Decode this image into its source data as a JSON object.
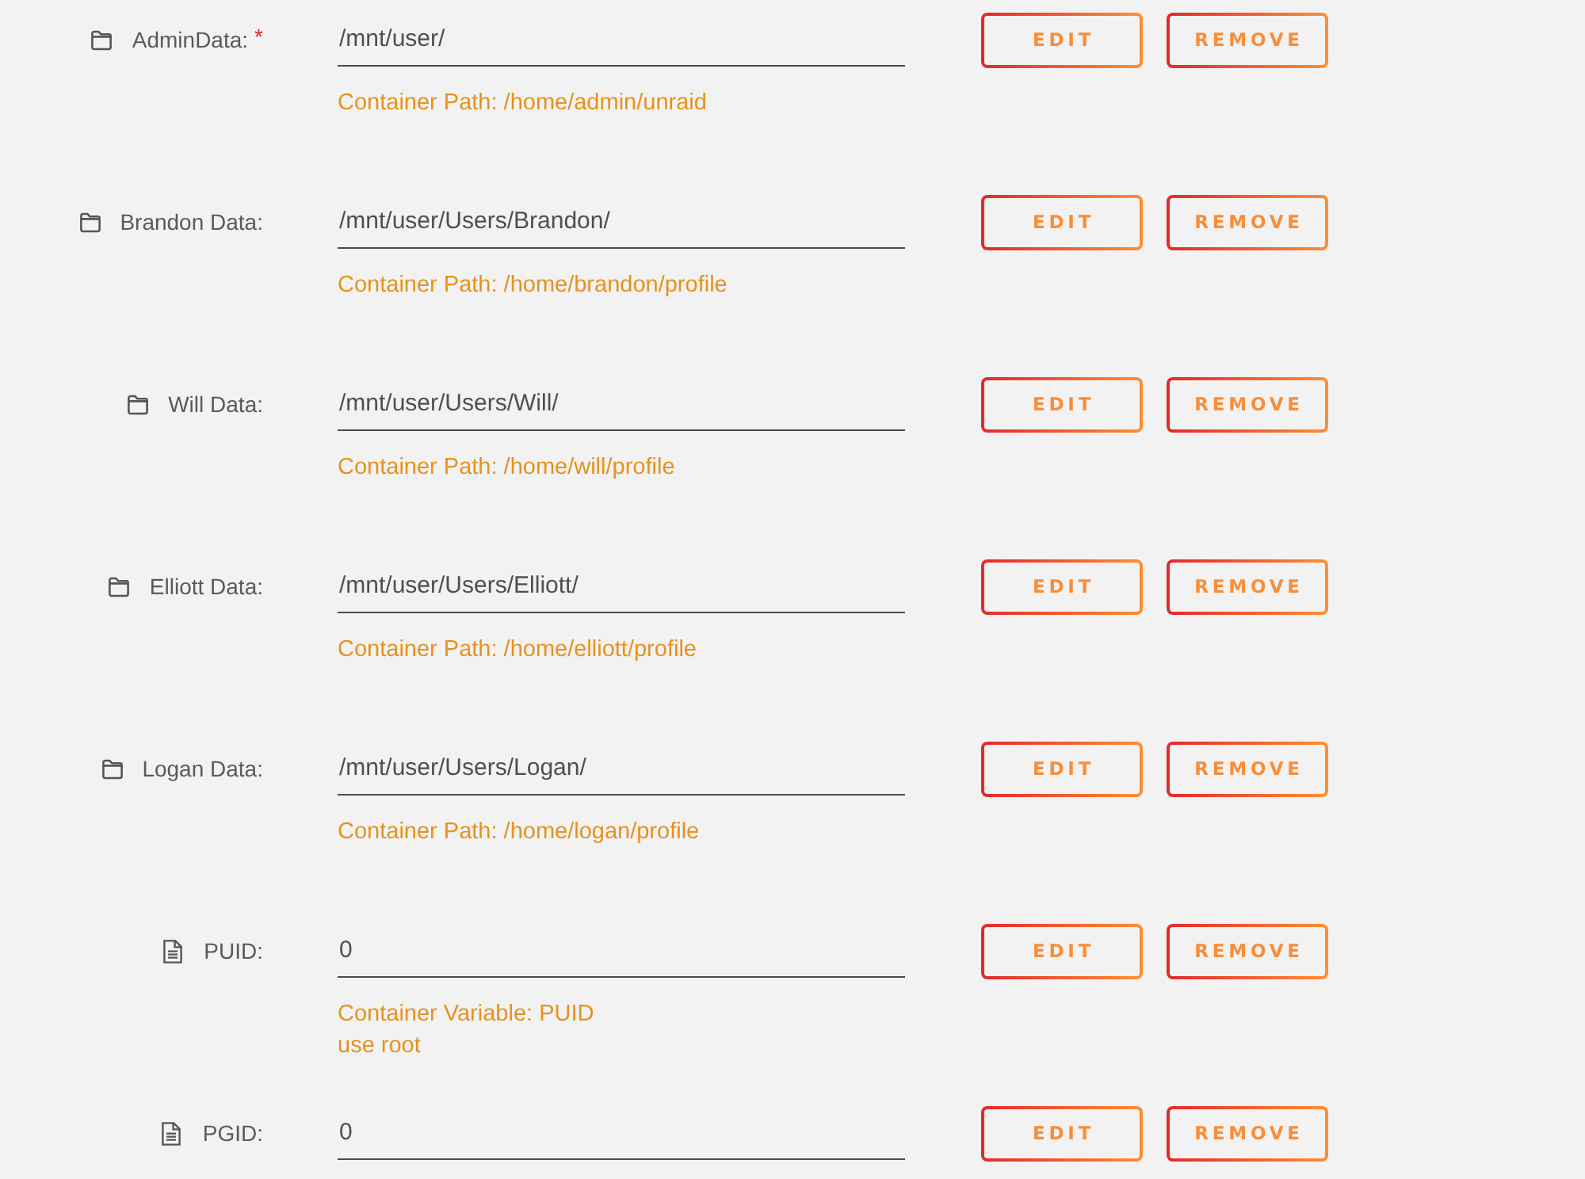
{
  "rows": [
    {
      "kind": "path",
      "label": "AdminData:",
      "required_mark": "*",
      "value": "/mnt/user/",
      "hint_lines": [
        "Container Path: /home/admin/unraid"
      ],
      "buttons": [
        "EDIT",
        "REMOVE"
      ]
    },
    {
      "kind": "path",
      "label": "Brandon Data:",
      "value": "/mnt/user/Users/Brandon/",
      "hint_lines": [
        "Container Path: /home/brandon/profile"
      ],
      "buttons": [
        "EDIT",
        "REMOVE"
      ]
    },
    {
      "kind": "path",
      "label": "Will Data:",
      "value": "/mnt/user/Users/Will/",
      "hint_lines": [
        "Container Path: /home/will/profile"
      ],
      "buttons": [
        "EDIT",
        "REMOVE"
      ]
    },
    {
      "kind": "path",
      "label": "Elliott Data:",
      "value": "/mnt/user/Users/Elliott/",
      "hint_lines": [
        "Container Path: /home/elliott/profile"
      ],
      "buttons": [
        "EDIT",
        "REMOVE"
      ]
    },
    {
      "kind": "path",
      "label": "Logan Data:",
      "value": "/mnt/user/Users/Logan/",
      "hint_lines": [
        "Container Path: /home/logan/profile"
      ],
      "buttons": [
        "EDIT",
        "REMOVE"
      ]
    },
    {
      "kind": "variable",
      "label": "PUID:",
      "value": "0",
      "hint_lines": [
        "Container Variable: PUID",
        "use root"
      ],
      "buttons": [
        "EDIT",
        "REMOVE"
      ]
    },
    {
      "kind": "variable",
      "label": "PGID:",
      "value": "0",
      "buttons": [
        "EDIT",
        "REMOVE"
      ]
    }
  ]
}
